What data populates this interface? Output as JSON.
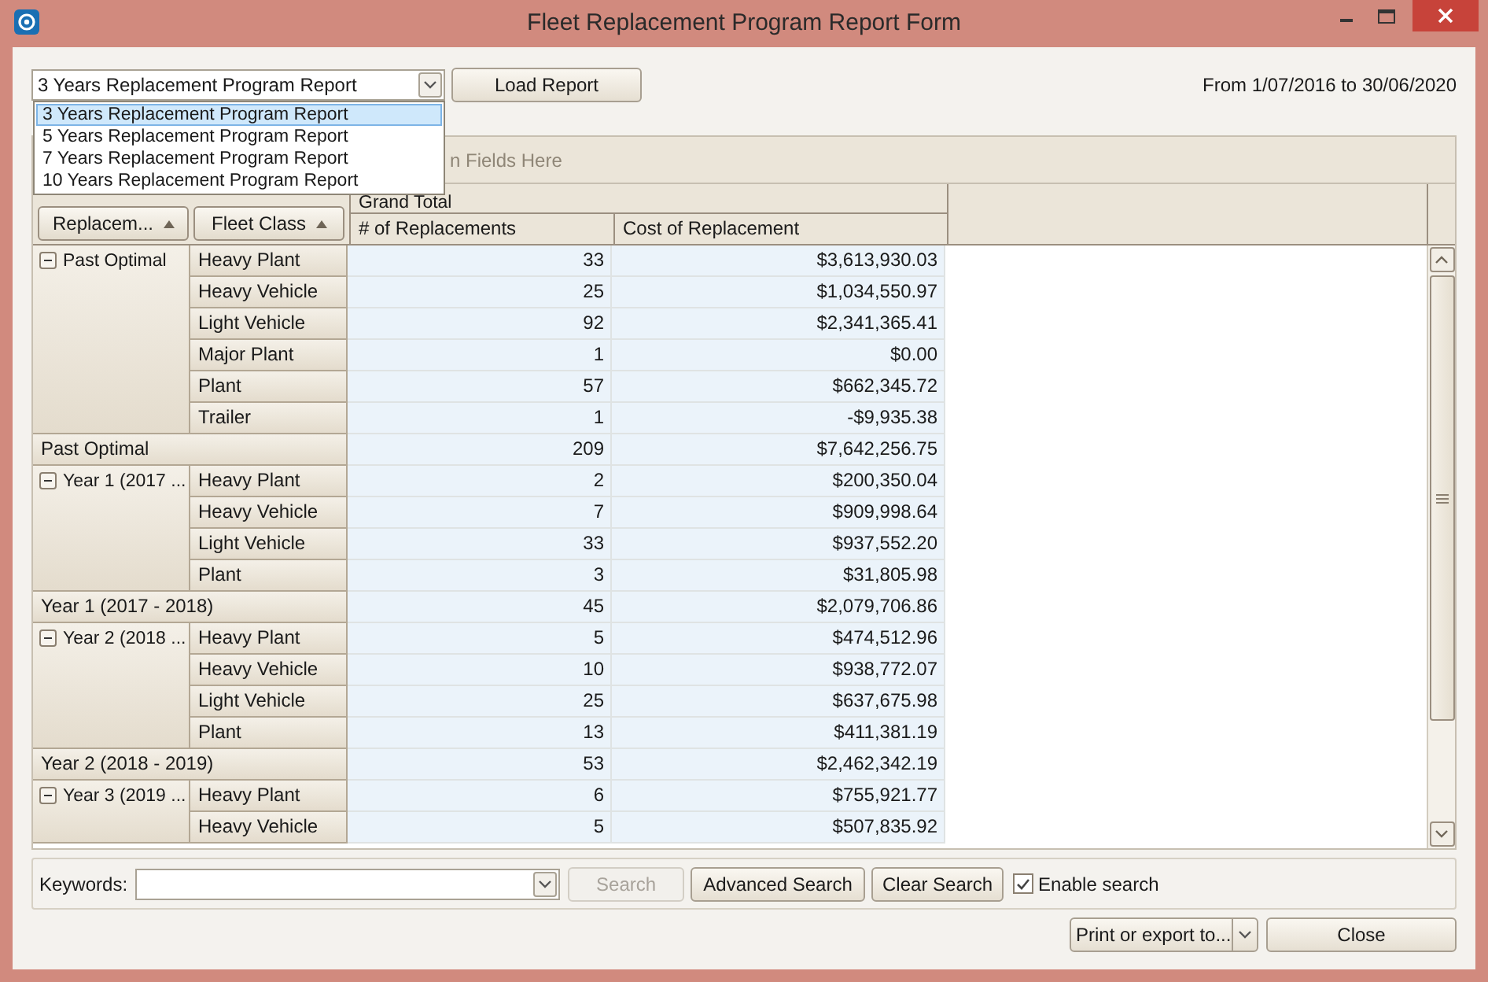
{
  "window": {
    "title": "Fleet Replacement Program Report Form"
  },
  "report_selector": {
    "value": "3 Years Replacement Program Report",
    "open": true,
    "options": [
      {
        "label": "3 Years Replacement Program Report",
        "selected": true
      },
      {
        "label": "5 Years Replacement Program Report",
        "selected": false
      },
      {
        "label": "7 Years Replacement Program Report",
        "selected": false
      },
      {
        "label": "10 Years Replacement Program Report",
        "selected": false
      }
    ]
  },
  "load_button": "Load Report",
  "date_range": "From 1/07/2016 to 30/06/2020",
  "pivot": {
    "filter_area": "n Fields Here",
    "grand_total": "Grand Total",
    "row_fields": [
      "Replacem...",
      "Fleet Class"
    ],
    "columns": [
      "# of Replacements",
      "Cost of Replacement"
    ],
    "groups": [
      {
        "label": "Past Optimal",
        "expanded": true,
        "items": [
          {
            "fleet_class": "Heavy Plant",
            "count": "33",
            "cost": "$3,613,930.03"
          },
          {
            "fleet_class": "Heavy Vehicle",
            "count": "25",
            "cost": "$1,034,550.97"
          },
          {
            "fleet_class": "Light Vehicle",
            "count": "92",
            "cost": "$2,341,365.41"
          },
          {
            "fleet_class": "Major Plant",
            "count": "1",
            "cost": "$0.00"
          },
          {
            "fleet_class": "Plant",
            "count": "57",
            "cost": "$662,345.72"
          },
          {
            "fleet_class": "Trailer",
            "count": "1",
            "cost": "-$9,935.38"
          }
        ],
        "total": {
          "label": "Past Optimal",
          "count": "209",
          "cost": "$7,642,256.75"
        }
      },
      {
        "label": "Year 1 (2017 ...",
        "expanded": true,
        "items": [
          {
            "fleet_class": "Heavy Plant",
            "count": "2",
            "cost": "$200,350.04"
          },
          {
            "fleet_class": "Heavy Vehicle",
            "count": "7",
            "cost": "$909,998.64"
          },
          {
            "fleet_class": "Light Vehicle",
            "count": "33",
            "cost": "$937,552.20"
          },
          {
            "fleet_class": "Plant",
            "count": "3",
            "cost": "$31,805.98"
          }
        ],
        "total": {
          "label": "Year 1 (2017 - 2018)",
          "count": "45",
          "cost": "$2,079,706.86"
        }
      },
      {
        "label": "Year 2 (2018 ...",
        "expanded": true,
        "items": [
          {
            "fleet_class": "Heavy Plant",
            "count": "5",
            "cost": "$474,512.96"
          },
          {
            "fleet_class": "Heavy Vehicle",
            "count": "10",
            "cost": "$938,772.07"
          },
          {
            "fleet_class": "Light Vehicle",
            "count": "25",
            "cost": "$637,675.98"
          },
          {
            "fleet_class": "Plant",
            "count": "13",
            "cost": "$411,381.19"
          }
        ],
        "total": {
          "label": "Year 2 (2018 - 2019)",
          "count": "53",
          "cost": "$2,462,342.19"
        }
      },
      {
        "label": "Year 3 (2019 ...",
        "expanded": true,
        "items": [
          {
            "fleet_class": "Heavy Plant",
            "count": "6",
            "cost": "$755,921.77"
          },
          {
            "fleet_class": "Heavy Vehicle",
            "count": "5",
            "cost": "$507,835.92"
          }
        ]
      }
    ]
  },
  "search": {
    "label": "Keywords:",
    "search_button": "Search",
    "search_disabled": true,
    "advanced_button": "Advanced Search",
    "clear_button": "Clear Search",
    "enable_label": "Enable search",
    "enable_checked": true
  },
  "footer": {
    "print_button": "Print or export to...",
    "close_button": "Close"
  }
}
